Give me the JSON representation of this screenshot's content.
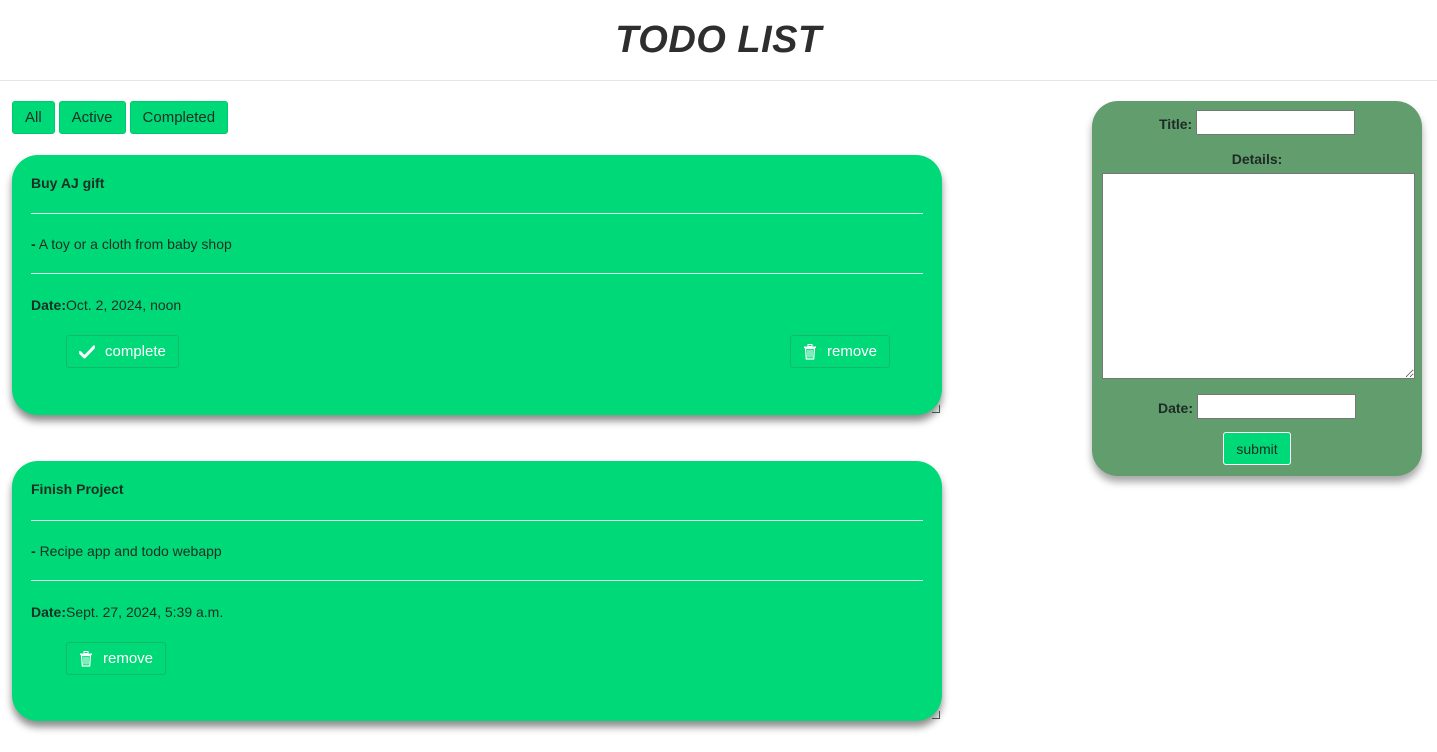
{
  "header": {
    "title": "TODO LIST"
  },
  "filters": [
    {
      "label": "All"
    },
    {
      "label": "Active"
    },
    {
      "label": "Completed"
    }
  ],
  "todos": [
    {
      "title": "Buy AJ gift",
      "details_prefix": "-",
      "details": "A toy or a cloth from baby shop",
      "date_label": "Date:",
      "date": "Oct. 2, 2024, noon",
      "complete_label": "complete",
      "remove_label": "remove"
    },
    {
      "title": "Finish Project",
      "details_prefix": "-",
      "details": "Recipe app and todo webapp",
      "date_label": "Date:",
      "date": "Sept. 27, 2024, 5:39 a.m.",
      "remove_label": "remove"
    }
  ],
  "form": {
    "title_label": "Title:",
    "title_value": "",
    "details_label": "Details:",
    "details_value": "",
    "date_label": "Date:",
    "date_value": "",
    "submit_label": "submit"
  },
  "colors": {
    "card_bg": "#00d977",
    "form_bg": "#629d6e",
    "button_bg": "#00d977"
  },
  "icons": {
    "complete": "check-icon",
    "remove": "trash-icon"
  }
}
